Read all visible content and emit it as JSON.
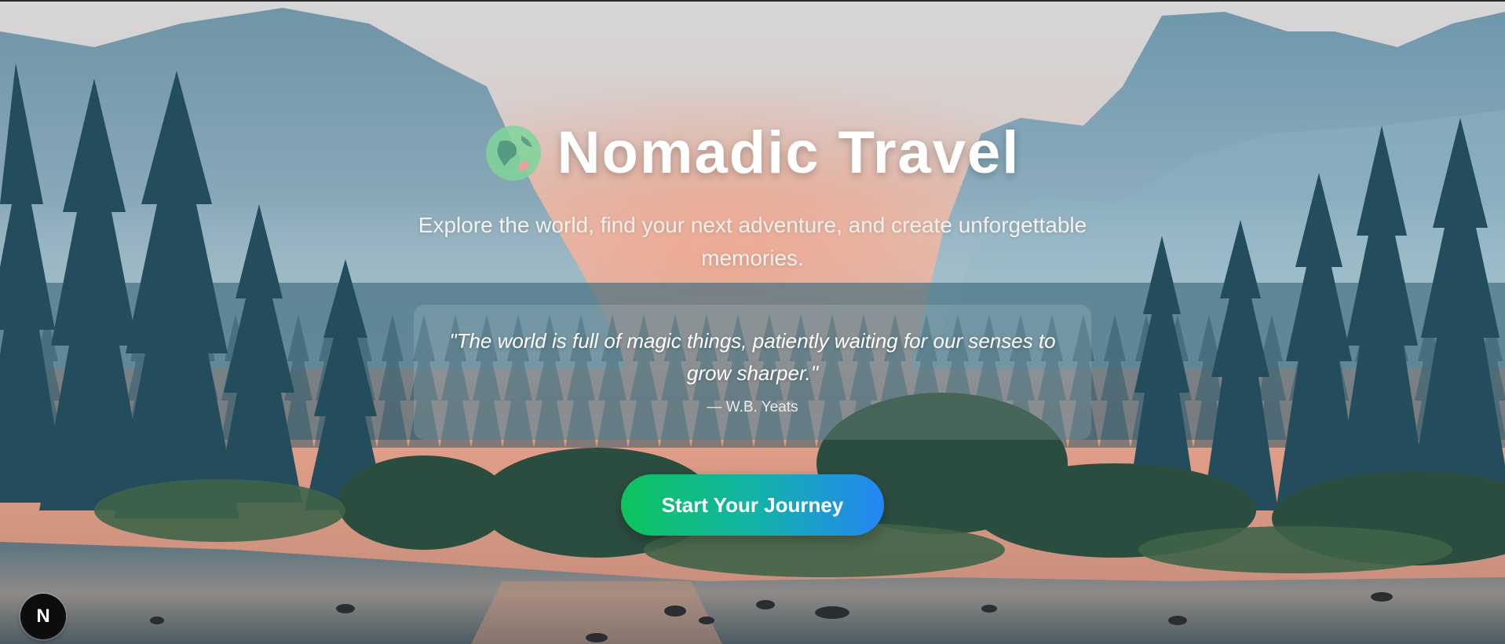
{
  "hero": {
    "title": "Nomadic Travel",
    "tagline": "Explore the world, find your next adventure, and create unforgettable memories.",
    "quote": {
      "text": "\"The world is full of magic things, patiently waiting for our senses to grow sharper.\"",
      "author": "— W.B. Yeats"
    },
    "cta_label": "Start Your Journey"
  },
  "dev_badge": {
    "label": "N"
  },
  "icons": {
    "brand": "globe-icon",
    "dev_badge": "nextjs-logo-icon"
  },
  "colors": {
    "cta_gradient_start": "#0dc45c",
    "cta_gradient_mid": "#13b3a6",
    "cta_gradient_end": "#2486f5",
    "globe": "#7fd39a",
    "title": "#ffffff"
  }
}
